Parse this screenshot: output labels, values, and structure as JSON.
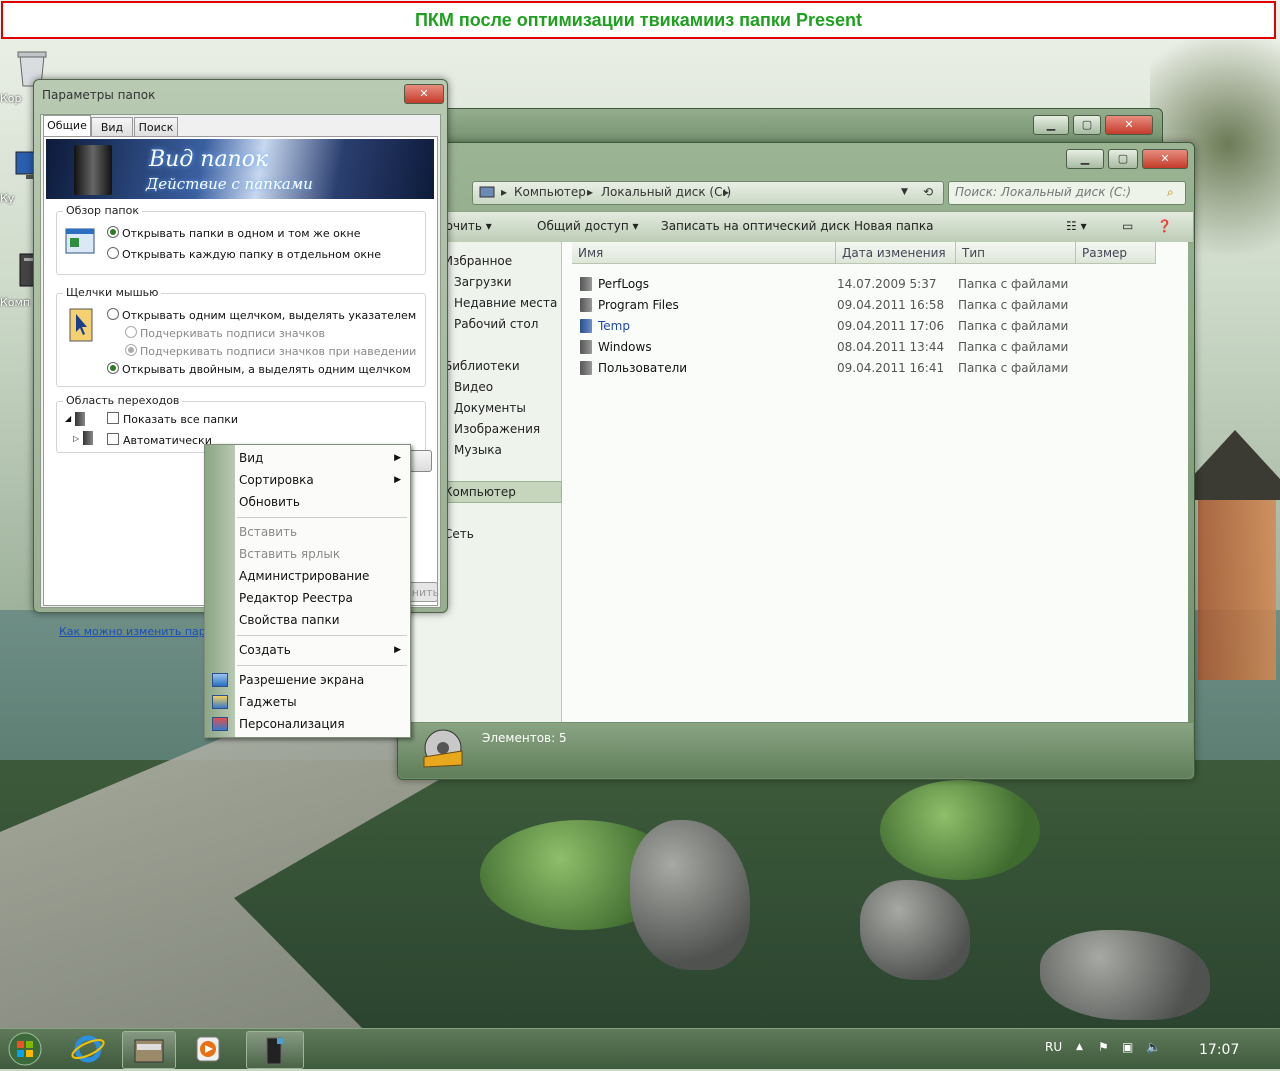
{
  "banner": {
    "text": "ПКМ после оптимизации твикамииз папки Present"
  },
  "desktop": {
    "icons": [
      {
        "label": "Кор"
      },
      {
        "label": "Ку"
      },
      {
        "label": "Комп"
      }
    ]
  },
  "explorer": {
    "address": {
      "segments": [
        "Компьютер",
        "Локальный диск (C:)"
      ]
    },
    "search_placeholder": "Поиск: Локальный диск (C:)",
    "toolbar": {
      "organize": "Упорядочить",
      "share": "Общий доступ",
      "burn": "Записать на оптический диск",
      "new_folder": "Новая папка"
    },
    "nav": {
      "favorites": "Избранное",
      "downloads": "Загрузки",
      "recent": "Недавние места",
      "desktop": "Рабочий стол",
      "libraries": "Библиотеки",
      "video": "Видео",
      "documents": "Документы",
      "images": "Изображения",
      "music": "Музыка",
      "computer": "Компьютер",
      "network": "Сеть"
    },
    "columns": {
      "name": "Имя",
      "date": "Дата изменения",
      "type": "Тип",
      "size": "Размер"
    },
    "files": [
      {
        "name": "PerfLogs",
        "date": "14.07.2009 5:37",
        "type": "Папка с файлами"
      },
      {
        "name": "Program Files",
        "date": "09.04.2011 16:58",
        "type": "Папка с файлами"
      },
      {
        "name": "Temp",
        "date": "09.04.2011 17:06",
        "type": "Папка с файлами"
      },
      {
        "name": "Windows",
        "date": "08.04.2011 13:44",
        "type": "Папка с файлами"
      },
      {
        "name": "Пользователи",
        "date": "09.04.2011 16:41",
        "type": "Папка с файлами"
      }
    ],
    "status": "Элементов: 5"
  },
  "dialog": {
    "title": "Параметры папок",
    "tabs": {
      "general": "Общие",
      "view": "Вид",
      "search": "Поиск"
    },
    "header": {
      "line1": "Вид папок",
      "line2": "Действие с папками"
    },
    "browse": {
      "title": "Обзор папок",
      "same_window": "Открывать папки в одном и том же окне",
      "new_window": "Открывать каждую папку в отдельном окне"
    },
    "click": {
      "title": "Щелчки мышью",
      "single": "Открывать одним щелчком, выделять указателем",
      "underline_always": "Подчеркивать подписи значков",
      "underline_hover": "Подчеркивать подписи значков при наведении",
      "double": "Открывать двойным, а выделять одним щелчком"
    },
    "nav": {
      "title": "Область переходов",
      "show_all": "Показать все папки",
      "auto": "Автоматически"
    },
    "link": "Как можно изменить параме",
    "apply_fragment": "енить"
  },
  "context_menu": {
    "view": "Вид",
    "sort": "Сортировка",
    "refresh": "Обновить",
    "paste": "Вставить",
    "paste_shortcut": "Вставить ярлык",
    "admin": "Администрирование",
    "regedit": "Редактор Реестра",
    "folder_props": "Свойства папки",
    "create": "Создать",
    "resolution": "Разрешение экрана",
    "gadgets": "Гаджеты",
    "personalize": "Персонализация"
  },
  "taskbar": {
    "lang": "RU",
    "time": "17:07"
  }
}
